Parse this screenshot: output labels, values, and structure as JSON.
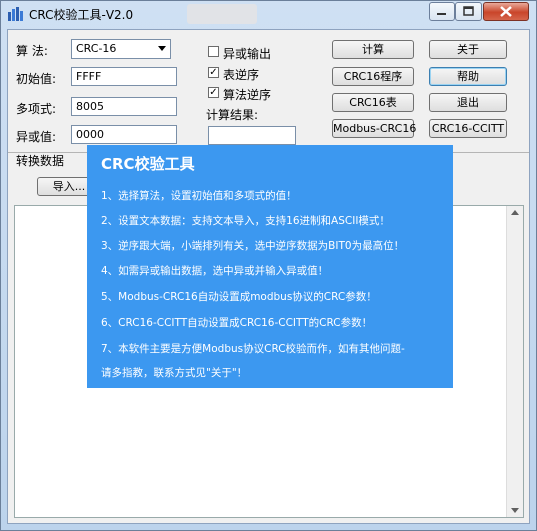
{
  "window": {
    "title": "CRC校验工具-V2.0",
    "ghost_tab": "",
    "buttons": {
      "minimize": "—",
      "maximize": "□",
      "close": "✕"
    }
  },
  "form": {
    "algo_label": "算  法:",
    "algo_value": "CRC-16",
    "init_label": "初始值:",
    "init_value": "FFFF",
    "poly_label": "多项式:",
    "poly_value": "8005",
    "xor_label": "异或值:",
    "xor_value": "0000",
    "convert_label": "转换数据",
    "import_button": "导入..."
  },
  "options": {
    "xor_output": {
      "label": "异或输出",
      "checked": false
    },
    "reverse_table": {
      "label": "表逆序",
      "checked": true
    },
    "reverse_algo": {
      "label": "算法逆序",
      "checked": true
    },
    "result_label": "计算结果:"
  },
  "buttons": {
    "calculate": "计算",
    "about": "关于",
    "crc16_program": "CRC16程序",
    "help": "帮助",
    "crc16_table": "CRC16表",
    "exit": "退出",
    "modbus": "Modbus-CRC16",
    "ccitt": "CRC16-CCITT"
  },
  "popup": {
    "title": "CRC校验工具",
    "lines": [
      "1、选择算法，设置初始值和多项式的值！",
      "2、设置文本数据：支持文本导入，支持16进制和ASCII模式！",
      "3、逆序跟大端，小端排列有关，选中逆序数据为BIT0为最高位！",
      "4、如需异或输出数据，选中异或并输入异或值！",
      "5、Modbus-CRC16自动设置成modbus协议的CRC参数！",
      "6、CRC16-CCITT自动设置成CRC16-CCITT的CRC参数！",
      "7、本软件主要是方便Modbus协议CRC校验而作，如有其他问题-",
      "   请多指教，联系方式见\"关于\"！"
    ]
  },
  "colors": {
    "popup_bg": "#3c98f0",
    "title_bar": "#c6daf0",
    "close_button": "#c9452a"
  }
}
